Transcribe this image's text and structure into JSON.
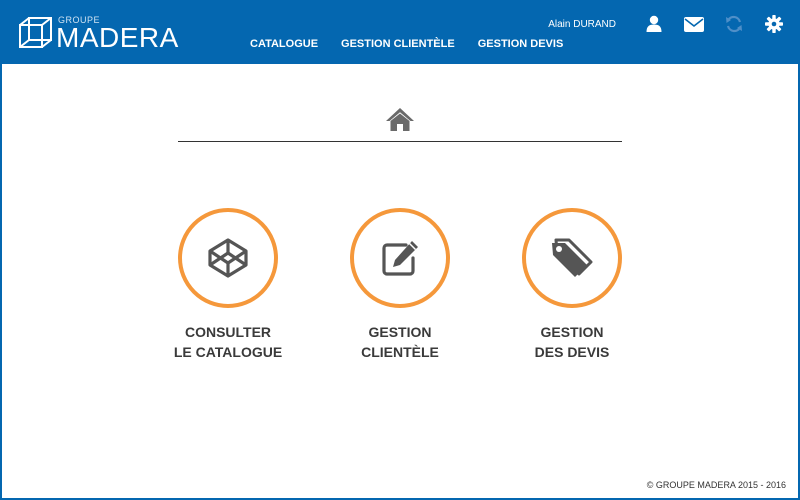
{
  "brand": {
    "group": "GROUPE",
    "name": "MADERA"
  },
  "nav": {
    "items": [
      {
        "label": "CATALOGUE"
      },
      {
        "label": "GESTION CLIENTÈLE"
      },
      {
        "label": "GESTION DEVIS"
      }
    ]
  },
  "user": {
    "name": "Alain DURAND"
  },
  "header_icons": [
    "user-icon",
    "mail-icon",
    "refresh-icon",
    "settings-icon"
  ],
  "tiles": [
    {
      "label": "CONSULTER\nLE CATALOGUE",
      "icon": "codepen-cube-icon"
    },
    {
      "label": "GESTION\nCLIENTÈLE",
      "icon": "edit-icon"
    },
    {
      "label": "GESTION\nDES DEVIS",
      "icon": "tags-icon"
    }
  ],
  "footer": {
    "copyright": "© GROUPE MADERA 2015 - 2016"
  },
  "colors": {
    "primary": "#0467b0",
    "accent": "#f5983b",
    "icon_gray": "#555555"
  }
}
